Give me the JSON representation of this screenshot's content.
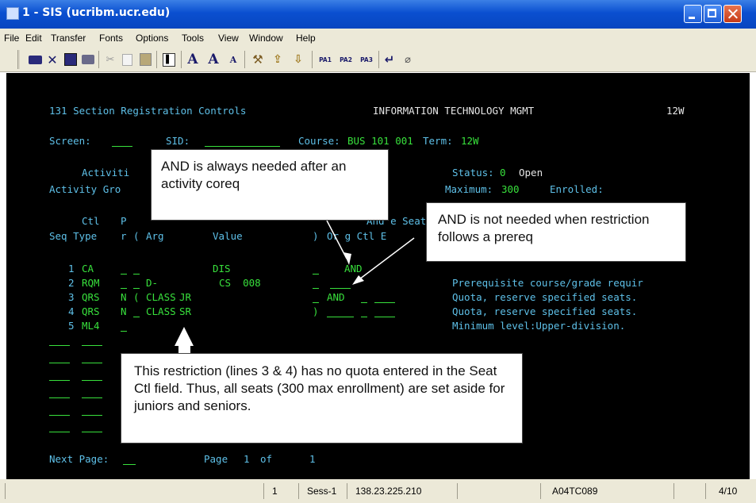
{
  "window": {
    "title": "1 - SIS (ucribm.ucr.edu)"
  },
  "menu": [
    "File",
    "Edit",
    "Transfer",
    "Fonts",
    "Options",
    "Tools",
    "View",
    "Window",
    "Help"
  ],
  "toolbar": {
    "pa1": "PA1",
    "pa2": "PA2",
    "pa3": "PA3",
    "font_a1": "A",
    "font_a2": "A",
    "font_a3": "A",
    "icons": [
      "printer-icon",
      "close-icon",
      "save-icon",
      "print-icon",
      "cut-icon",
      "copy-icon",
      "paste-icon",
      "cursor-icon",
      "font-large-icon",
      "font-grow-icon",
      "font-small-icon",
      "tools-icon",
      "send-icon",
      "receive-icon",
      "pa1-key",
      "pa2-key",
      "pa3-key",
      "enter-icon",
      "erase-icon"
    ]
  },
  "terminal": {
    "header_left": "131 Section Registration Controls",
    "header_mid": "INFORMATION TECHNOLOGY MGMT",
    "header_right": "12W",
    "screen_label": "Screen:",
    "sid_label": "SID:",
    "course_label": "Course:",
    "course_value": "BUS 101 001",
    "term_label": "Term:",
    "term_value": "12W",
    "activity_label": "Activiti",
    "activity_group_label": "Activity Gro",
    "status_label": "Status:",
    "status_code": "0",
    "status_text": "Open",
    "maximum_label": "Maximum:",
    "maximum_value": "300",
    "enrolled_label": "Enrolled:",
    "hdr_ctl": "Ctl",
    "hdr_p": "P",
    "hdr_seq_type": "Seq Type",
    "hdr_r": "r",
    "hdr_paren": "(",
    "hdr_arg": "Arg",
    "hdr_value": "Value",
    "hdr_close_paren": ")",
    "hdr_and_or": "And e Seat",
    "hdr_org_ctl": "Or g Ctl E",
    "rows": [
      {
        "seq": "1",
        "type": "CA",
        "p": "",
        "arg": "",
        "value": "DIS",
        "andor": "AND",
        "desc": ""
      },
      {
        "seq": "2",
        "type": "RQM",
        "p": "",
        "arg": "D-",
        "value": "CS  008",
        "andor": "",
        "desc": "Prerequisite course/grade requir"
      },
      {
        "seq": "3",
        "type": "QRS",
        "p": "N",
        "paren": "(",
        "arg": "CLASS",
        "value": "JR",
        "andor": "AND",
        "desc": "Quota, reserve specified seats."
      },
      {
        "seq": "4",
        "type": "QRS",
        "p": "N",
        "arg": "CLASS",
        "value": "SR",
        "close": ")",
        "andor": "",
        "desc": "Quota, reserve specified seats."
      },
      {
        "seq": "5",
        "type": "ML4",
        "p": "",
        "arg": "",
        "value": "",
        "andor": "",
        "desc": "Minimum level:Upper-division."
      }
    ],
    "next_page_label": "Next Page:",
    "page_label": "Page",
    "page_num": "1",
    "page_of": "of",
    "page_total": "1"
  },
  "callouts": {
    "c1": "AND is always needed after an activity coreq",
    "c2": "AND is not needed when restriction follows a prereq",
    "c3": "This restriction (lines 3 & 4) has no quota entered in the Seat Ctl field.  Thus, all seats (300 max enrollment) are set aside for juniors and seniors."
  },
  "statusbar": {
    "session_num": "1",
    "session": "Sess-1",
    "ip": "138.23.225.210",
    "lu": "A04TC089",
    "cursor": "4/10"
  },
  "colors": {
    "title_blue": "#0a4fd0",
    "terminal_bg": "#000000",
    "terminal_cyan": "#5ec0e8",
    "terminal_green": "#38e03c",
    "terminal_white": "#e6e6e6"
  }
}
